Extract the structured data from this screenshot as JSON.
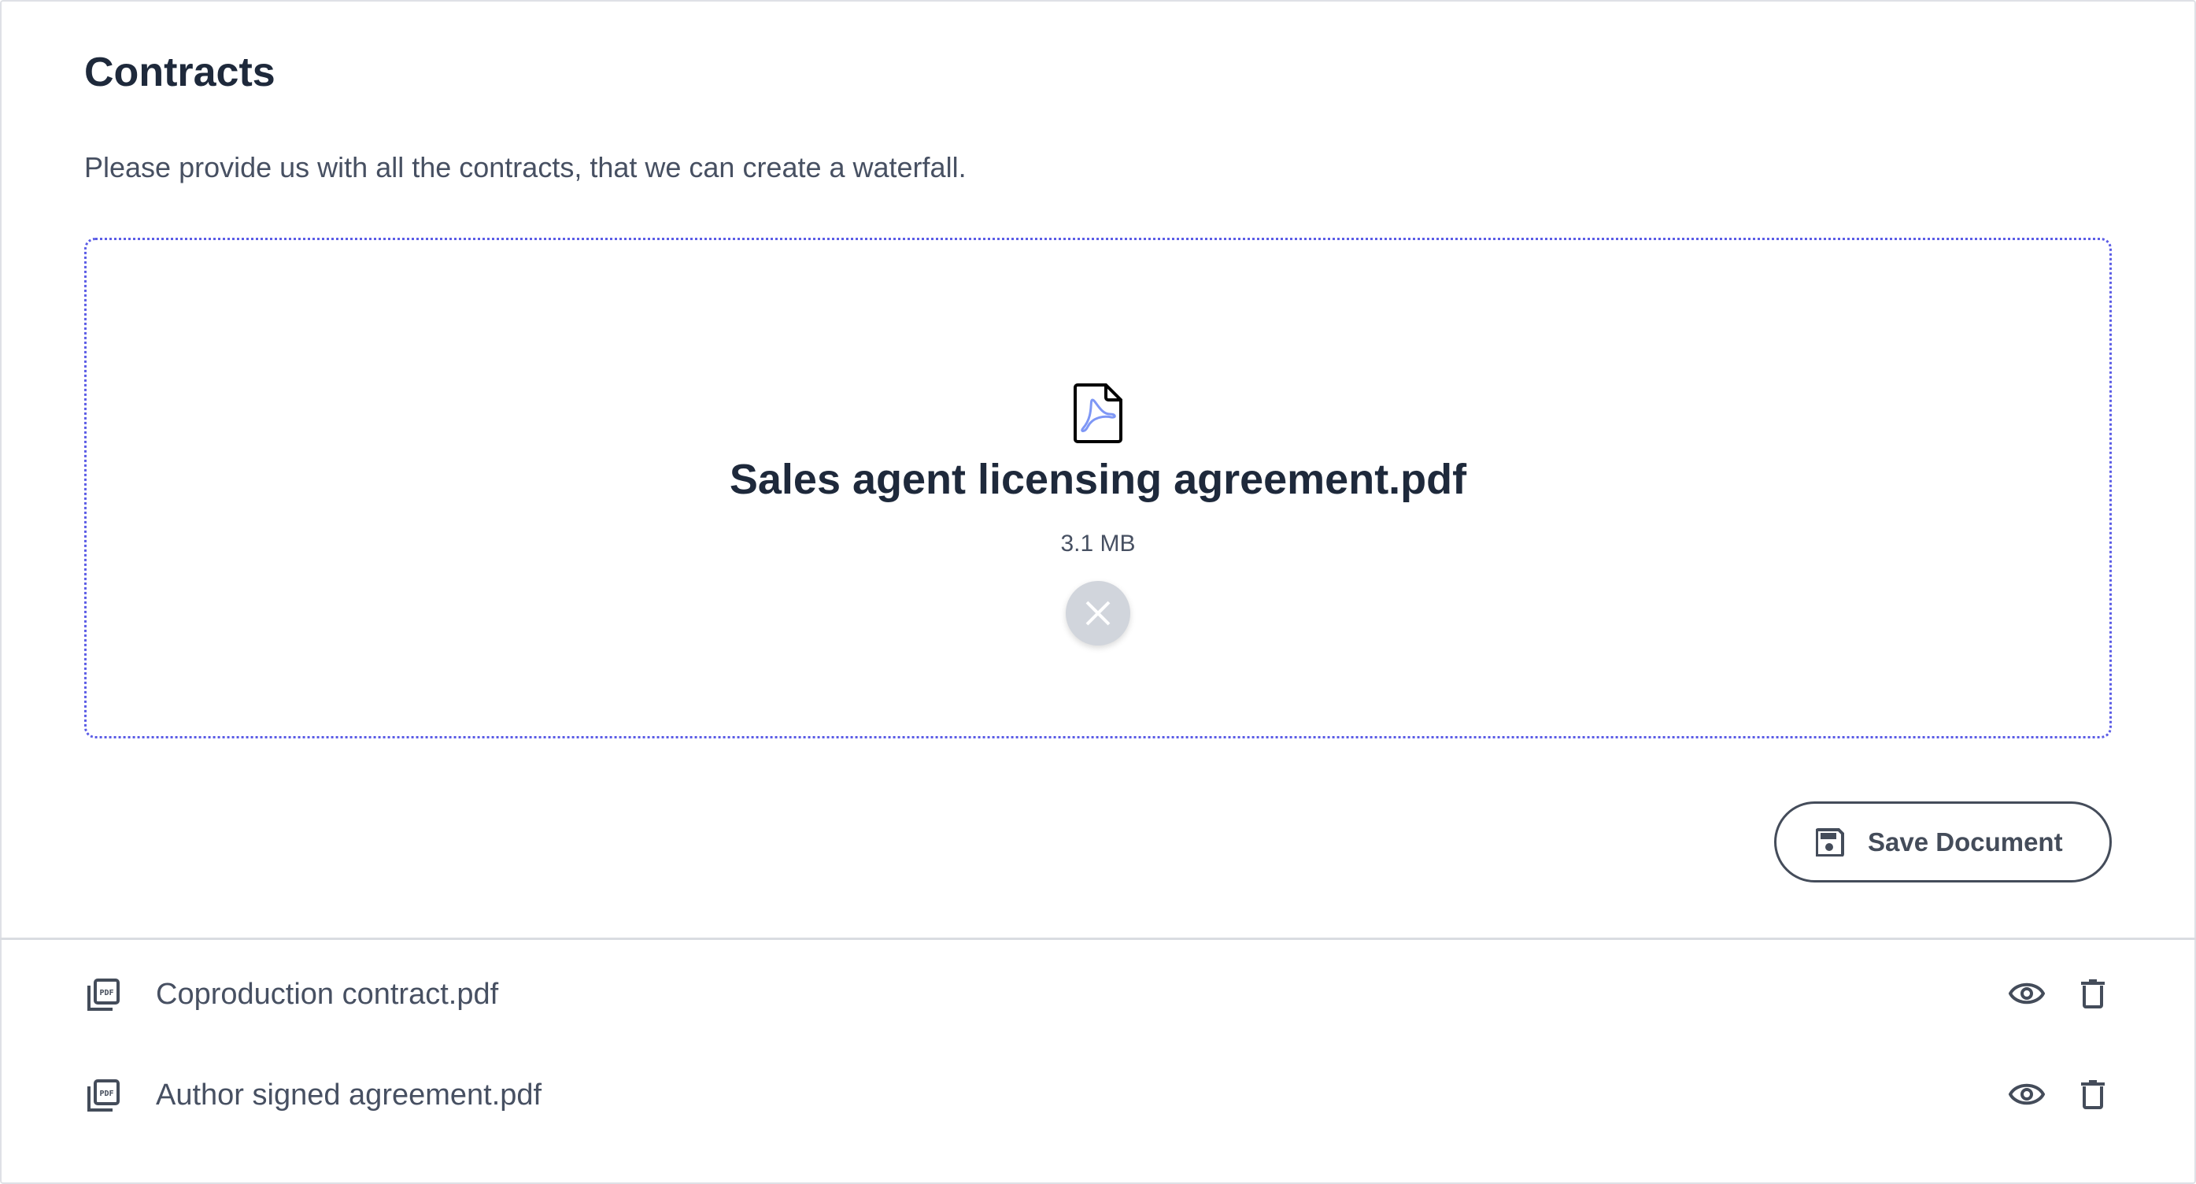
{
  "header": {
    "title": "Contracts",
    "subtitle": "Please provide us with all the contracts, that we can create a waterfall."
  },
  "upload": {
    "file_name": "Sales agent licensing agreement.pdf",
    "file_size": "3.1 MB",
    "icon": "pdf-file-icon",
    "remove_icon": "close-icon",
    "accent": "#5b5ce6"
  },
  "actions": {
    "save_label": "Save Document",
    "save_icon": "floppy-disk-icon"
  },
  "files": [
    {
      "name": "Coproduction contract.pdf",
      "icon": "pdf-stack-icon"
    },
    {
      "name": "Author signed agreement.pdf",
      "icon": "pdf-stack-icon"
    }
  ]
}
